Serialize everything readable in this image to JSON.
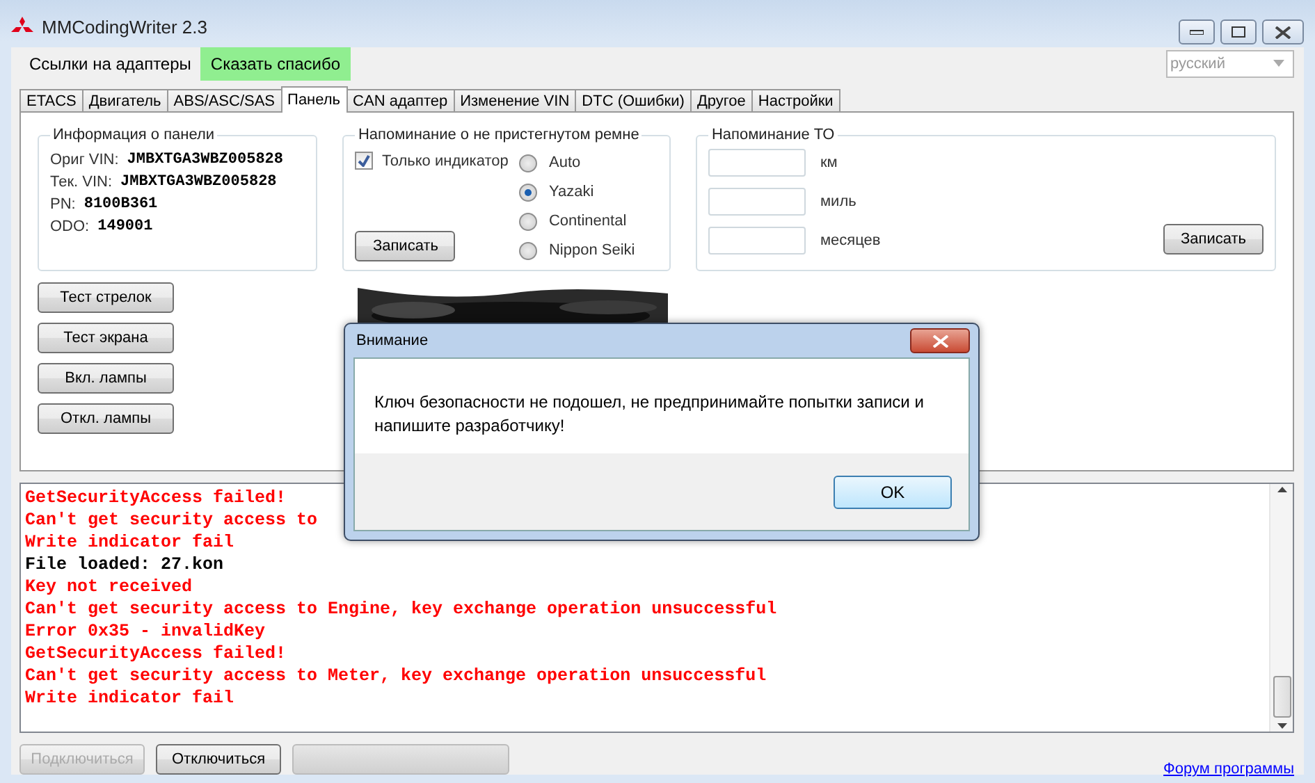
{
  "window": {
    "title": "MMCodingWriter 2.3"
  },
  "menu": [
    {
      "label": "Ссылки на адаптеры",
      "kind": "plain"
    },
    {
      "label": "Сказать спасибо",
      "kind": "highlight"
    }
  ],
  "language": {
    "value": "русский",
    "disabled": true
  },
  "tabs": [
    {
      "label": "ETACS",
      "selected": false
    },
    {
      "label": "Двигатель",
      "selected": false
    },
    {
      "label": "ABS/ASC/SAS",
      "selected": false
    },
    {
      "label": "Панель",
      "selected": true
    },
    {
      "label": "CAN адаптер",
      "selected": false
    },
    {
      "label": "Изменение VIN",
      "selected": false
    },
    {
      "label": "DTC (Ошибки)",
      "selected": false
    },
    {
      "label": "Другое",
      "selected": false
    },
    {
      "label": "Настройки",
      "selected": false
    }
  ],
  "panel_info": {
    "title": "Информация о панели",
    "rows": [
      {
        "label": "Ориг VIN:",
        "value": "JMBXTGA3WBZ005828"
      },
      {
        "label": "Тек. VIN:",
        "value": "JMBXTGA3WBZ005828"
      },
      {
        "label": "PN:",
        "value": "8100B361"
      },
      {
        "label": "ODO:",
        "value": "149001"
      }
    ]
  },
  "belt_reminder": {
    "title": "Напоминание о не пристегнутом ремне",
    "checkbox": {
      "label": "Только индикатор",
      "checked": true
    },
    "radios": [
      {
        "label": "Auto",
        "selected": false
      },
      {
        "label": "Yazaki",
        "selected": true
      },
      {
        "label": "Continental",
        "selected": false
      },
      {
        "label": "Nippon Seiki",
        "selected": false
      }
    ],
    "button": "Записать"
  },
  "service_reminder": {
    "title": "Напоминание ТО",
    "fields": [
      {
        "unit": "км"
      },
      {
        "unit": "миль"
      },
      {
        "unit": "месяцев"
      }
    ],
    "button": "Записать"
  },
  "test_buttons": [
    "Тест стрелок",
    "Тест экрана",
    "Вкл. лампы",
    "Откл. лампы"
  ],
  "log": [
    {
      "text": "GetSecurityAccess failed!",
      "color": "#ff0000"
    },
    {
      "text": "Can't get security access to",
      "color": "#ff0000"
    },
    {
      "text": "Write indicator fail",
      "color": "#ff0000"
    },
    {
      "text": "File loaded: 27.kon",
      "color": "#000000"
    },
    {
      "text": "Key not received",
      "color": "#ff0000"
    },
    {
      "text": "Can't get security access to Engine, key exchange operation unsuccessful",
      "color": "#ff0000"
    },
    {
      "text": "Error 0x35 - invalidKey",
      "color": "#ff0000"
    },
    {
      "text": "GetSecurityAccess failed!",
      "color": "#ff0000"
    },
    {
      "text": "Can't get security access to Meter, key exchange operation unsuccessful",
      "color": "#ff0000"
    },
    {
      "text": "Write indicator fail",
      "color": "#ff0000"
    }
  ],
  "bottom_buttons": [
    {
      "label": "Подключиться",
      "disabled": true
    },
    {
      "label": "Отключиться",
      "disabled": false
    }
  ],
  "progress": {
    "level": 0
  },
  "forum_link": "Форум программы",
  "dialog": {
    "title": "Внимание",
    "message": "Ключ безопасности не подошел, не предпринимайте попытки записи и напишите разработчику!",
    "button": "OK"
  }
}
